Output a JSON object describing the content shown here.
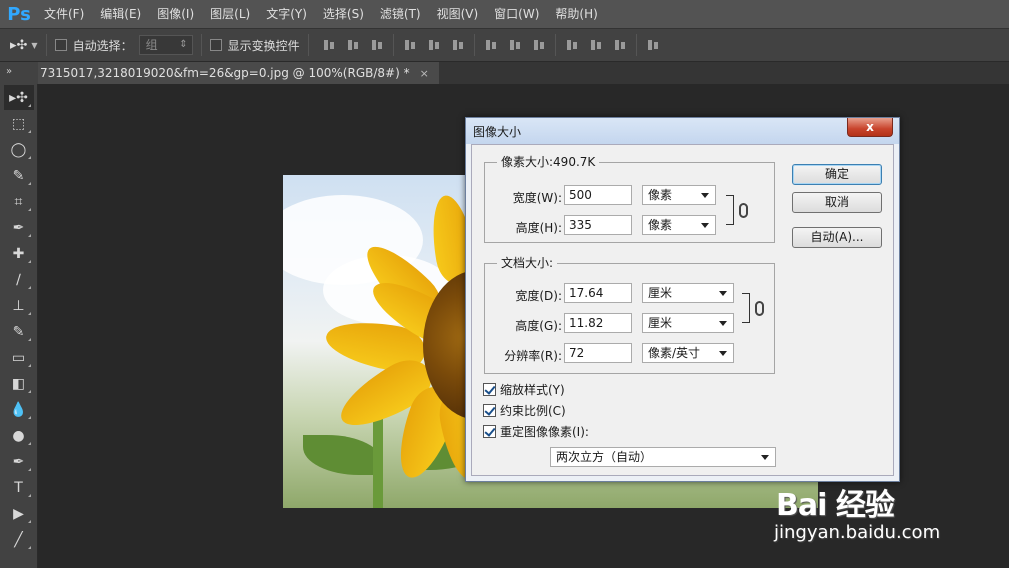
{
  "app": {
    "logo": "Ps"
  },
  "menu": [
    "文件(F)",
    "编辑(E)",
    "图像(I)",
    "图层(L)",
    "文字(Y)",
    "选择(S)",
    "滤镜(T)",
    "视图(V)",
    "窗口(W)",
    "帮助(H)"
  ],
  "options": {
    "auto_select_label": "自动选择：",
    "auto_select_value": "组",
    "show_transform_label": "显示变换控件"
  },
  "tab": {
    "collapse": "»",
    "doc_title": "7315017,3218019020&fm=26&gp=0.jpg @ 100%(RGB/8#) *",
    "close": "×"
  },
  "tools": [
    "move-tool-icon",
    "marquee-tool-icon",
    "lasso-tool-icon",
    "quick-select-tool-icon",
    "crop-tool-icon",
    "eyedropper-tool-icon",
    "healing-brush-tool-icon",
    "brush-tool-icon",
    "clone-stamp-tool-icon",
    "history-brush-tool-icon",
    "eraser-tool-icon",
    "paint-bucket-tool-icon",
    "blur-tool-icon",
    "dodge-tool-icon",
    "pen-tool-icon",
    "type-tool-icon",
    "path-select-tool-icon",
    "line-tool-icon"
  ],
  "tool_glyphs": [
    "▸✣",
    "⬚",
    "◯",
    "✎",
    "⌗",
    "✒",
    "✚",
    "∕",
    "⊥",
    "✎",
    "▭",
    "◧",
    "💧",
    "●",
    "✒",
    "T",
    "▶",
    "╱"
  ],
  "dialog": {
    "title": "图像大小",
    "close": "x",
    "pixel_dimensions": {
      "legend": "像素大小:490.7K",
      "width_label": "宽度(W):",
      "width_value": "500",
      "width_unit": "像素",
      "height_label": "高度(H):",
      "height_value": "335",
      "height_unit": "像素"
    },
    "document_size": {
      "legend": "文档大小:",
      "width_label": "宽度(D):",
      "width_value": "17.64",
      "width_unit": "厘米",
      "height_label": "高度(G):",
      "height_value": "11.82",
      "height_unit": "厘米",
      "resolution_label": "分辨率(R):",
      "resolution_value": "72",
      "resolution_unit": "像素/英寸"
    },
    "buttons": {
      "ok": "确定",
      "cancel": "取消",
      "auto": "自动(A)..."
    },
    "checkboxes": {
      "scale_styles": "缩放样式(Y)",
      "constrain_proportions": "约束比例(C)",
      "resample": "重定图像像素(I):"
    },
    "resample_method": "两次立方（自动）"
  },
  "watermark": {
    "brand": "Bai 经验",
    "url": "jingyan.baidu.com"
  }
}
